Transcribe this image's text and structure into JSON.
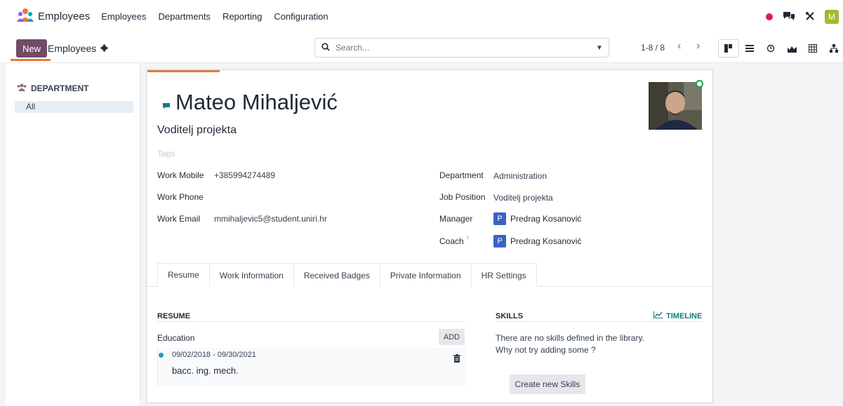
{
  "navbar": {
    "app_name": "Employees",
    "menu": [
      "Employees",
      "Departments",
      "Reporting",
      "Configuration"
    ],
    "user_initial": "M"
  },
  "control": {
    "new_label": "New",
    "breadcrumb": "Employees",
    "search_placeholder": "Search...",
    "pager": "1-8 / 8"
  },
  "sidebar": {
    "title": "DEPARTMENT",
    "items": [
      "All"
    ]
  },
  "record": {
    "name": "Mateo Mihaljević",
    "job_title": "Voditelj projekta",
    "tags_placeholder": "Tags",
    "left_fields": [
      {
        "label": "Work Mobile",
        "value": "+385994274489"
      },
      {
        "label": "Work Phone",
        "value": ""
      },
      {
        "label": "Work Email",
        "value": "mmihaljevic5@student.uniri.hr"
      }
    ],
    "department": {
      "label": "Department",
      "value": "Administration"
    },
    "job_position": {
      "label": "Job Position",
      "value": "Voditelj projekta"
    },
    "manager": {
      "label": "Manager",
      "initial": "P",
      "value": "Predrag Kosanović"
    },
    "coach": {
      "label": "Coach",
      "help": "?",
      "initial": "P",
      "value": "Predrag Kosanović"
    }
  },
  "tabs": [
    "Resume",
    "Work Information",
    "Received Badges",
    "Private Information",
    "HR Settings"
  ],
  "resume": {
    "title": "RESUME",
    "section": "Education",
    "add_label": "ADD",
    "entry_date": "09/02/2018 - 09/30/2021",
    "entry_name": "bacc. ing. mech."
  },
  "skills": {
    "title": "SKILLS",
    "timeline_label": "TIMELINE",
    "empty_line1": "There are no skills defined in the library.",
    "empty_line2": "Why not try adding some ?",
    "create_label": "Create new Skills"
  },
  "colors": {
    "brand": "#714b67",
    "accent": "#e57a3c",
    "teal": "#0e7c86",
    "badge": "#3b63c4"
  }
}
